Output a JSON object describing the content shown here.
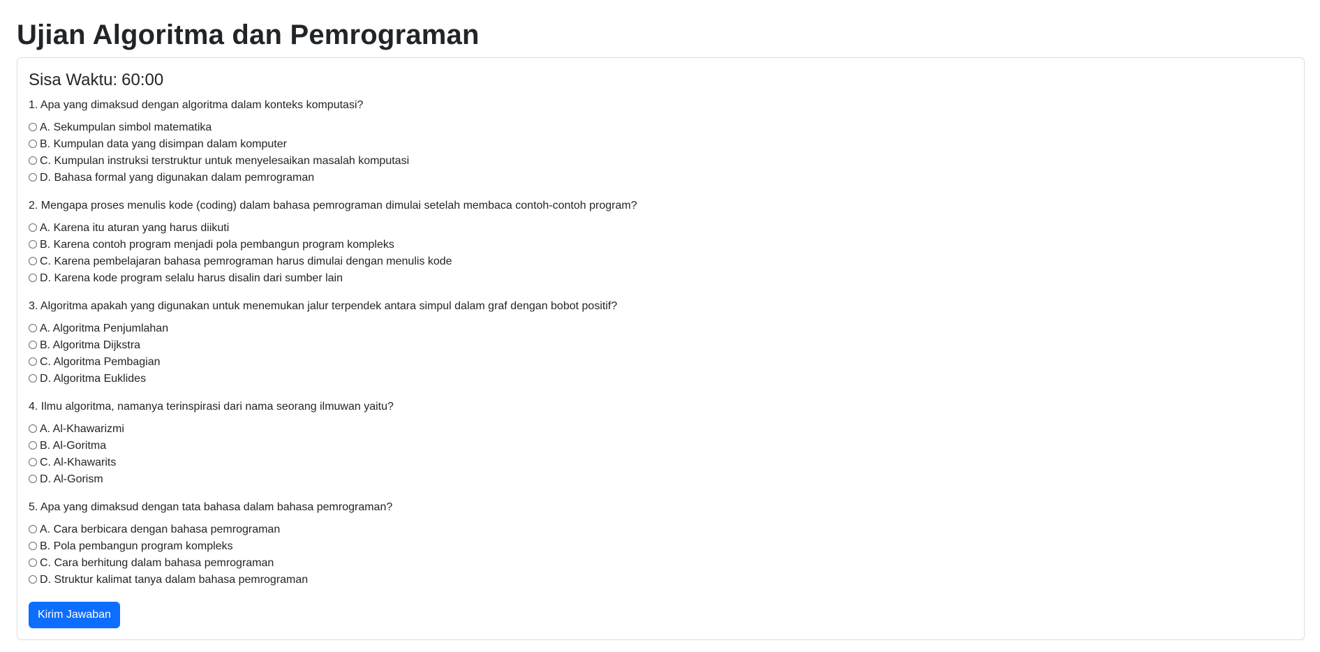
{
  "page": {
    "title": "Ujian Algoritma dan Pemrograman"
  },
  "timer": {
    "label": "Sisa Waktu:",
    "value": "60:00"
  },
  "questions": [
    {
      "text": "1. Apa yang dimaksud dengan algoritma dalam konteks komputasi?",
      "options": [
        "A. Sekumpulan simbol matematika",
        "B. Kumpulan data yang disimpan dalam komputer",
        "C. Kumpulan instruksi terstruktur untuk menyelesaikan masalah komputasi",
        "D. Bahasa formal yang digunakan dalam pemrograman"
      ]
    },
    {
      "text": "2. Mengapa proses menulis kode (coding) dalam bahasa pemrograman dimulai setelah membaca contoh-contoh program?",
      "options": [
        "A. Karena itu aturan yang harus diikuti",
        "B. Karena contoh program menjadi pola pembangun program kompleks",
        "C. Karena pembelajaran bahasa pemrograman harus dimulai dengan menulis kode",
        "D. Karena kode program selalu harus disalin dari sumber lain"
      ]
    },
    {
      "text": "3. Algoritma apakah yang digunakan untuk menemukan jalur terpendek antara simpul dalam graf dengan bobot positif?",
      "options": [
        "A. Algoritma Penjumlahan",
        "B. Algoritma Dijkstra",
        "C. Algoritma Pembagian",
        "D. Algoritma Euklides"
      ]
    },
    {
      "text": "4. Ilmu algoritma, namanya terinspirasi dari nama seorang ilmuwan yaitu?",
      "options": [
        "A. Al-Khawarizmi",
        "B. Al-Goritma",
        "C. Al-Khawarits",
        "D. Al-Gorism"
      ]
    },
    {
      "text": "5. Apa yang dimaksud dengan tata bahasa dalam bahasa pemrograman?",
      "options": [
        "A. Cara berbicara dengan bahasa pemrograman",
        "B. Pola pembangun program kompleks",
        "C. Cara berhitung dalam bahasa pemrograman",
        "D. Struktur kalimat tanya dalam bahasa pemrograman"
      ]
    }
  ],
  "submit": {
    "label": "Kirim Jawaban",
    "color": "#0d6efd"
  }
}
